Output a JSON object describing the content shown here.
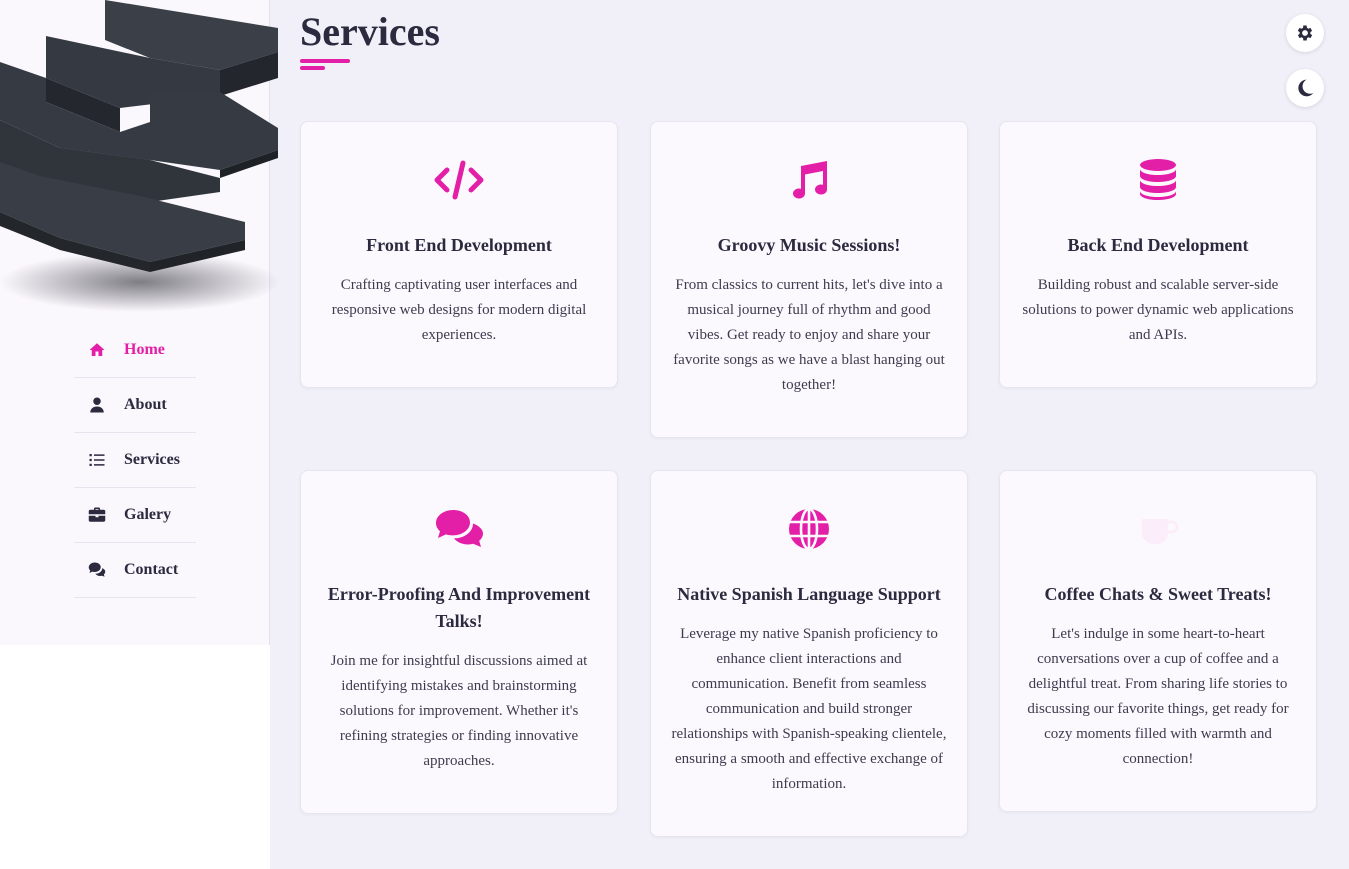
{
  "header": {
    "title": "Services"
  },
  "colors": {
    "accent": "#e41fa7",
    "text": "#2b2a3e",
    "background": "#f1f0f8",
    "card": "#fcf9fe"
  },
  "sidebar": {
    "items": [
      {
        "label": "Home",
        "icon": "home-icon",
        "active": true
      },
      {
        "label": "About",
        "icon": "user-icon",
        "active": false
      },
      {
        "label": "Services",
        "icon": "list-icon",
        "active": false
      },
      {
        "label": "Galery",
        "icon": "briefcase-icon",
        "active": false
      },
      {
        "label": "Contact",
        "icon": "comments-icon",
        "active": false
      }
    ]
  },
  "controls": {
    "settings_icon": "gear-icon",
    "theme_icon": "moon-icon"
  },
  "services": [
    {
      "icon": "code-icon",
      "title": "Front End Development",
      "text": "Crafting captivating user interfaces and responsive web designs for modern digital experiences."
    },
    {
      "icon": "music-icon",
      "title": "Groovy Music Sessions!",
      "text": "From classics to current hits, let's dive into a musical journey full of rhythm and good vibes. Get ready to enjoy and share your favorite songs as we have a blast hanging out together!"
    },
    {
      "icon": "database-icon",
      "title": "Back End Development",
      "text": "Building robust and scalable server-side solutions to power dynamic web applications and APIs."
    },
    {
      "icon": "comments-icon",
      "title": "Error-Proofing And Improvement Talks!",
      "text": "Join me for insightful discussions aimed at identifying mistakes and brainstorming solutions for improvement. Whether it's refining strategies or finding innovative approaches."
    },
    {
      "icon": "globe-icon",
      "title": "Native Spanish Language Support",
      "text": "Leverage my native Spanish proficiency to enhance client interactions and communication. Benefit from seamless communication and build stronger relationships with Spanish-speaking clientele, ensuring a smooth and effective exchange of information."
    },
    {
      "icon": "coffee-icon",
      "title": "Coffee Chats & Sweet Treats!",
      "text": "Let's indulge in some heart-to-heart conversations over a cup of coffee and a delightful treat. From sharing life stories to discussing our favorite things, get ready for cozy moments filled with warmth and connection!"
    }
  ]
}
